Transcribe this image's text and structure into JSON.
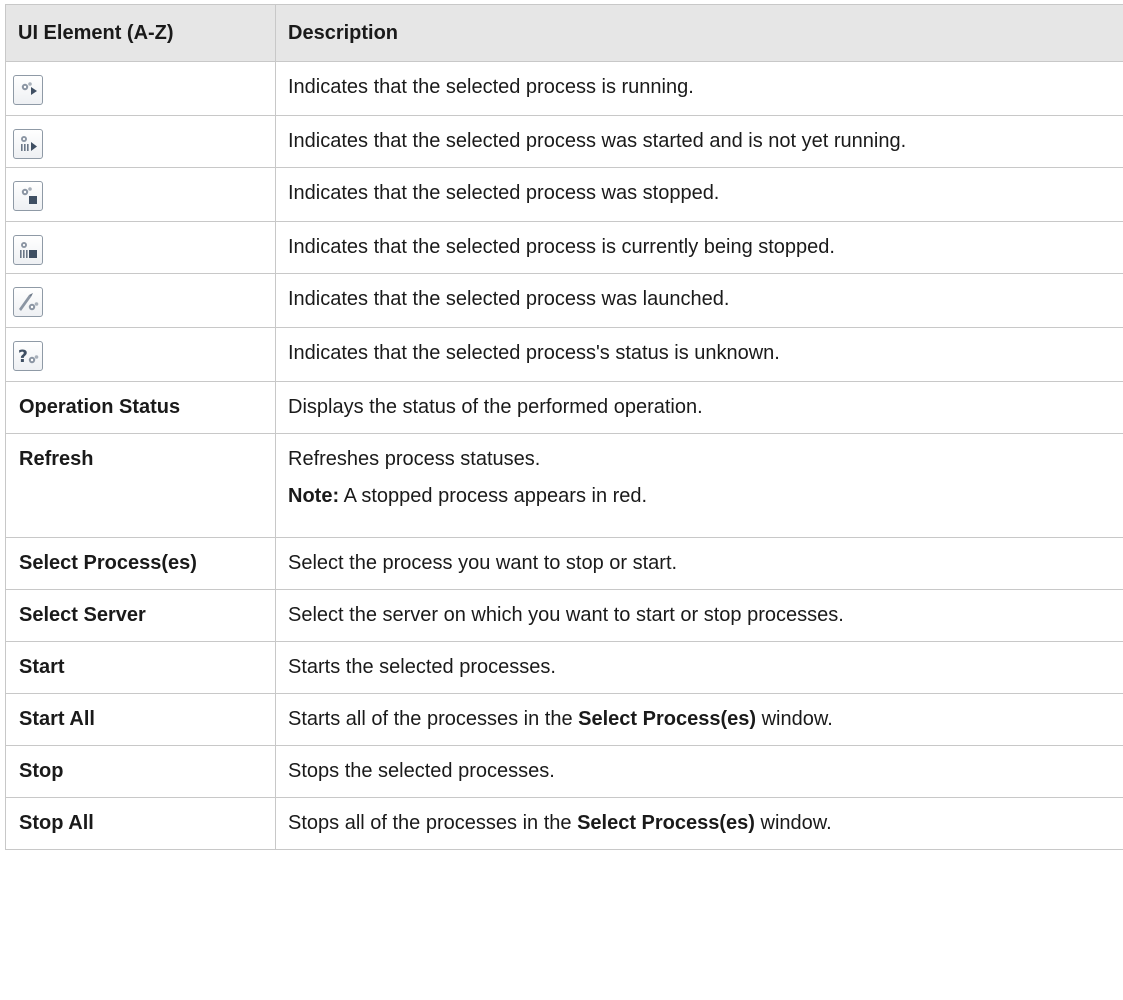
{
  "header": {
    "col_element": "UI Element (A-Z)",
    "col_description": "Description"
  },
  "icon_rows": [
    {
      "icon": "process-running-icon",
      "description": "Indicates that the selected process is running."
    },
    {
      "icon": "process-starting-icon",
      "description": "Indicates that the selected process was started and is not yet running."
    },
    {
      "icon": "process-stopped-icon",
      "description": "Indicates that the selected process was stopped."
    },
    {
      "icon": "process-stopping-icon",
      "description": "Indicates that the selected process is currently being stopped."
    },
    {
      "icon": "process-launched-icon",
      "description": "Indicates that the selected process was launched."
    },
    {
      "icon": "process-unknown-icon",
      "description": "Indicates that the selected process's status is unknown."
    }
  ],
  "rows": {
    "operation_status": {
      "element": "Operation Status",
      "description": "Displays the status of the performed operation."
    },
    "refresh": {
      "element": "Refresh",
      "description": "Refreshes process statuses.",
      "note_label": "Note:",
      "note_text": " A stopped process appears in red."
    },
    "select_processes": {
      "element": "Select Process(es)",
      "description": "Select the process you want to stop or start."
    },
    "select_server": {
      "element": "Select Server",
      "description": "Select the server on which you want to start or stop processes."
    },
    "start": {
      "element": "Start",
      "description": "Starts the selected processes."
    },
    "start_all": {
      "element": "Start All",
      "desc_pre": "Starts all of the processes in the ",
      "desc_bold": "Select Process(es)",
      "desc_post": " window."
    },
    "stop": {
      "element": "Stop",
      "description": "Stops the selected processes."
    },
    "stop_all": {
      "element": "Stop All",
      "desc_pre": "Stops all of the processes in the ",
      "desc_bold": "Select Process(es)",
      "desc_post": " window."
    }
  },
  "colors": {
    "header_bg": "#e6e6e6",
    "border": "#c8c8c8",
    "icon_border": "#8f9aa6",
    "gear": "#8b95a3",
    "arrow": "#3f4f63"
  }
}
